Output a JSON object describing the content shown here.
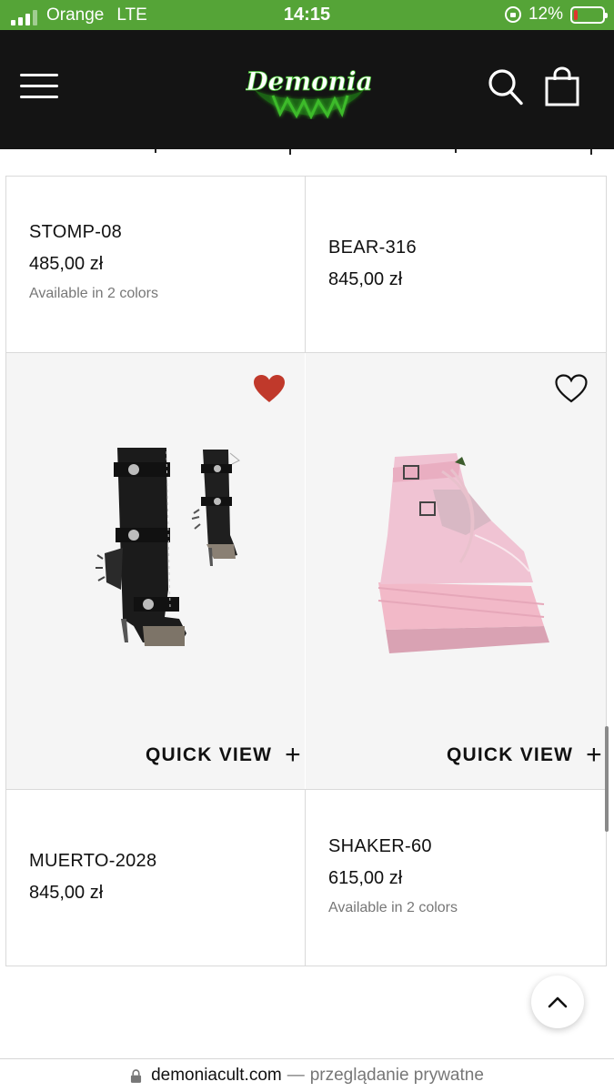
{
  "status_bar": {
    "carrier": "Orange",
    "network": "LTE",
    "time": "14:15",
    "battery_percent": "12%",
    "battery_level": 0.12,
    "bar_color": "#55a437"
  },
  "header": {
    "logo_text": "Demonia",
    "background": "#141414",
    "logo_glow_color": "#3dbb2a"
  },
  "products": [
    {
      "name": "STOMP-08",
      "price": "485,00 zł",
      "colors": "Available in 2 colors"
    },
    {
      "name": "BEAR-316",
      "price": "845,00 zł",
      "colors": ""
    },
    {
      "name": "MUERTO-2028",
      "price": "845,00 zł",
      "colors": "",
      "favorited": true,
      "image": "black-knee-high-spiked-platform-boot",
      "quick_view": "QUICK VIEW"
    },
    {
      "name": "SHAKER-60",
      "price": "615,00 zł",
      "colors": "Available in 2 colors",
      "favorited": false,
      "image": "pink-holographic-wedge-ankle-boot",
      "quick_view": "QUICK VIEW"
    }
  ],
  "accent": {
    "heart_filled": "#c0392b"
  },
  "bottom_bar": {
    "domain": "demoniacult.com",
    "separator": "—",
    "mode": "przeglądanie prywatne"
  }
}
